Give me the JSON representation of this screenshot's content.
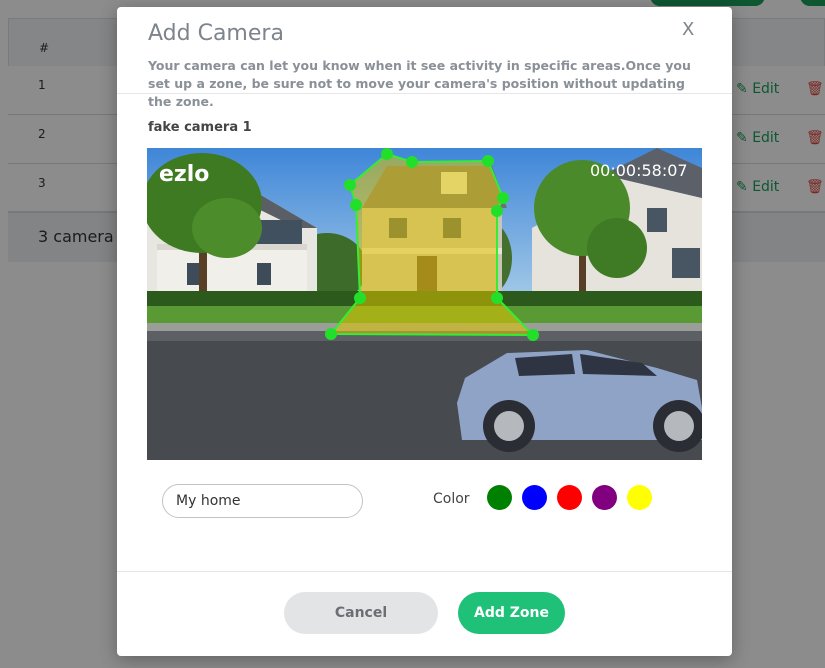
{
  "background": {
    "table": {
      "header": "#",
      "rows": [
        {
          "num": "1",
          "edit": "Edit",
          "delete": "De"
        },
        {
          "num": "2",
          "edit": "Edit",
          "delete": "De"
        },
        {
          "num": "3",
          "edit": "Edit",
          "delete": "De"
        }
      ],
      "footer": "3 camera"
    }
  },
  "modal": {
    "title": "Add Camera",
    "close": "X",
    "description": "Your camera can let you know when it see activity in specific areas.Once you set up a zone, be sure not to move your camera's position without updating the zone.",
    "camera_name": "fake camera 1",
    "video": {
      "logo": "ezlo",
      "timestamp": "00:00:58:07"
    },
    "zone_name": {
      "value": "My home"
    },
    "color_label": "Color",
    "colors": [
      "#008000",
      "#0000ff",
      "#ff0000",
      "#800080",
      "#ffff00"
    ],
    "cancel_label": "Cancel",
    "add_label": "Add Zone"
  },
  "accent": {
    "green": "#1fc178",
    "zone_outline": "#33ee33",
    "zone_fill": "#e0c200"
  }
}
